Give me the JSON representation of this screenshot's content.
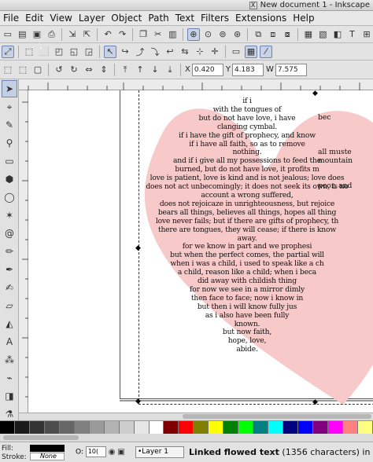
{
  "window": {
    "title": "New document 1 - Inkscape",
    "close_glyph": "X"
  },
  "menu": [
    "File",
    "Edit",
    "View",
    "Layer",
    "Object",
    "Path",
    "Text",
    "Filters",
    "Extensions",
    "Help"
  ],
  "controls": {
    "x_label": "X",
    "x_value": "0.420",
    "y_label": "Y",
    "y_value": "4.183",
    "w_label": "W",
    "w_value": "7.575"
  },
  "poem_lines": [
    "if i",
    "with the tongues of",
    "but do not have love, i have",
    "clanging cymbal.",
    "if i have the gift of prophecy, and know",
    "if i have all faith, so as to remove",
    "nothing.",
    "and if i give all my possessions to feed the",
    "burned, but do not have love, it profits m",
    "love is patient, love is kind and is not jealous; love does",
    "does not act unbecomingly; it does not seek its own, is no",
    "account a wrong suffered,",
    "does not rejoicaze in unrighteousness, but rejoice",
    "bears all things, believes all things, hopes all thing",
    "love never fails; but if there are gifts of prophecy, th",
    "there are tongues, they will cease; if there is know",
    "away.",
    "for we know in part and we prophesi",
    "but when the perfect comes, the partial will",
    "when i was a child, i used to speak like a ch",
    "a child, reason like a child; when i beca",
    "did away with childish thing",
    "for now we see in a mirror dimly",
    "then face to face; now i know in",
    "but then i will know fully jus",
    "as i also have been fully",
    "known.",
    "but now faith,",
    "hope, love,",
    "abide."
  ],
  "poem_right_lines": [
    "bec",
    "",
    "",
    "",
    "all muste",
    "mountain",
    "",
    "",
    "poor, and",
    "",
    "",
    "",
    "",
    "",
    "",
    "",
    "",
    "",
    "",
    "",
    "",
    "",
    "",
    "",
    "",
    "",
    "",
    "",
    "",
    ""
  ],
  "heart_color": "#f7c9c9",
  "palette_colors": [
    "#000000",
    "#1a1a1a",
    "#333333",
    "#4d4d4d",
    "#666666",
    "#808080",
    "#999999",
    "#b3b3b3",
    "#cccccc",
    "#e6e6e6",
    "#ffffff",
    "#800000",
    "#ff0000",
    "#808000",
    "#ffff00",
    "#008000",
    "#00ff00",
    "#008080",
    "#00ffff",
    "#000080",
    "#0000ff",
    "#800080",
    "#ff00ff",
    "#ff8080",
    "#ffff80"
  ],
  "status": {
    "fill_label": "Fill:",
    "stroke_label": "Stroke:",
    "stroke_value": "None",
    "opacity_label": "O:",
    "opacity_value": "10(",
    "layer": "•Layer 1",
    "message_bold": "Linked flowed text",
    "message_rest": "(1356 characters) in laye"
  }
}
